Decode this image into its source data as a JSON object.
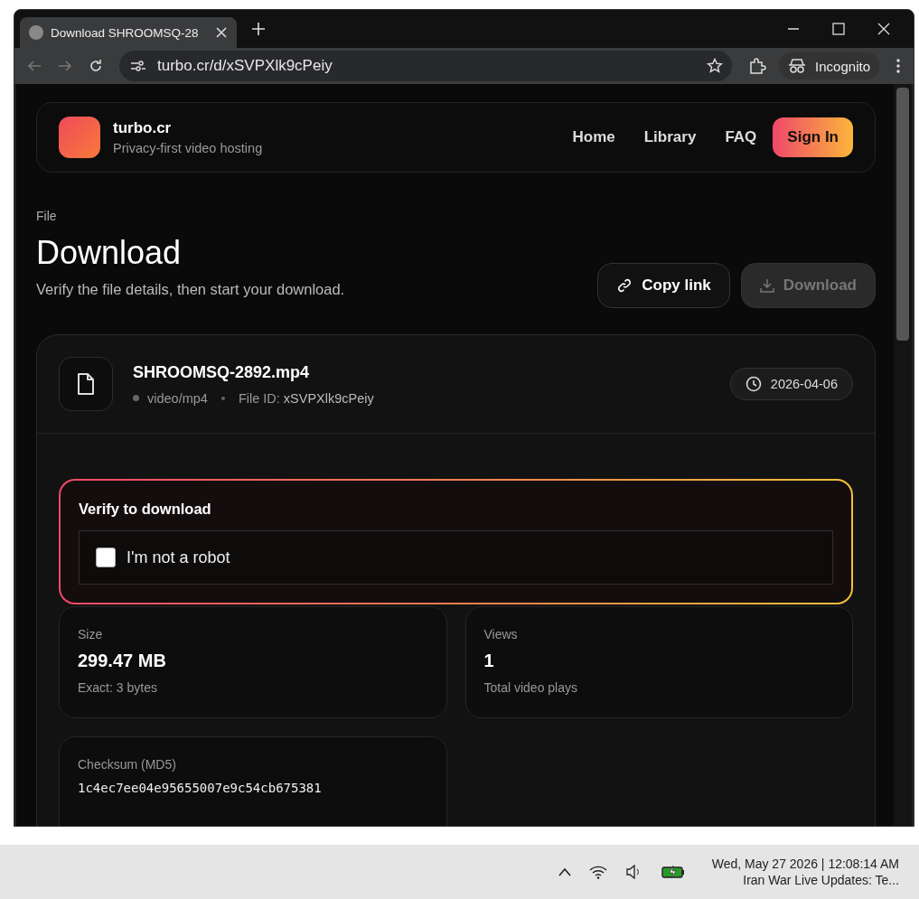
{
  "browser": {
    "tab_title": "Download SHROOMSQ-28",
    "url": "turbo.cr/d/xSVPXlk9cPeiy",
    "profile": "Incognito"
  },
  "site": {
    "name": "turbo.cr",
    "tagline": "Privacy-first video hosting",
    "nav": [
      "Home",
      "Library",
      "FAQ"
    ],
    "sign_in": "Sign In"
  },
  "page": {
    "eyebrow": "File",
    "title": "Download",
    "subtitle": "Verify the file details, then start your download.",
    "copy_button": "Copy link",
    "download_button": {
      "label": "Download",
      "disabled": true
    }
  },
  "file": {
    "name": "SHROOMSQ-2892.mp4",
    "type": "video/mp4",
    "id_label": "File ID:",
    "id": "xSVPXlk9cPeiy",
    "date": "2026-04-06"
  },
  "verify": {
    "title": "Verify to download",
    "label": "I'm not a robot",
    "checked": false
  },
  "stats": [
    {
      "label": "Size",
      "value": "299.47 MB",
      "note": "Exact: 3 bytes",
      "kind": "stat"
    },
    {
      "label": "Views",
      "value": "1",
      "note": "Total video plays",
      "kind": "stat"
    },
    {
      "label": "Checksum (MD5)",
      "value": "1c4ec7ee04e95655007e9c54cb675381",
      "kind": "hash"
    }
  ],
  "taskbar": {
    "datetime": "Wed, May 27 2026 | 12:08:14 AM",
    "news": "Iran War Live Updates: Te..."
  }
}
